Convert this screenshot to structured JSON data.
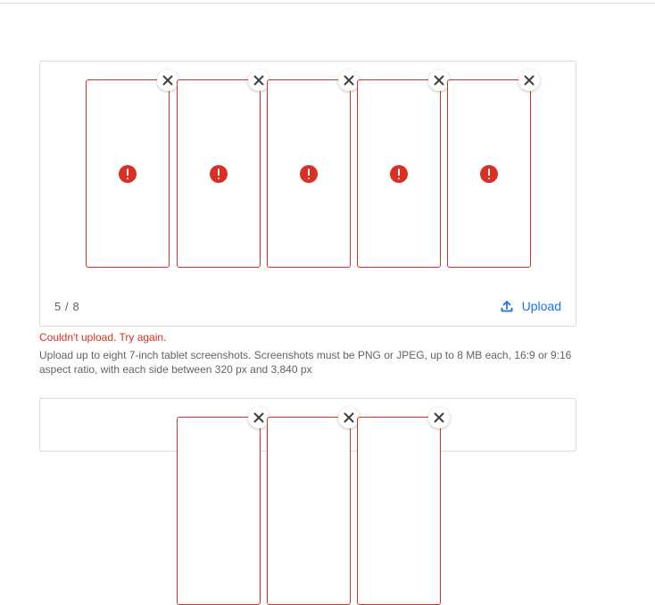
{
  "panel_main": {
    "count": "5 / 8",
    "upload_label": "Upload",
    "slots": [
      {
        "status": "error",
        "icon": "error-icon"
      },
      {
        "status": "error",
        "icon": "error-icon"
      },
      {
        "status": "error",
        "icon": "error-icon"
      },
      {
        "status": "error",
        "icon": "error-icon"
      },
      {
        "status": "error",
        "icon": "error-icon"
      }
    ]
  },
  "messages": {
    "error": "Couldn't upload. Try again.",
    "help": "Upload up to eight 7-inch tablet screenshots. Screenshots must be PNG or JPEG, up to 8 MB each, 16:9 or 9:16 aspect ratio, with each side between 320 px and 3,840 px"
  },
  "colors": {
    "error": "#d93025",
    "accent": "#1a73e8",
    "border": "#dadce0",
    "muted_text": "#5f6368"
  }
}
